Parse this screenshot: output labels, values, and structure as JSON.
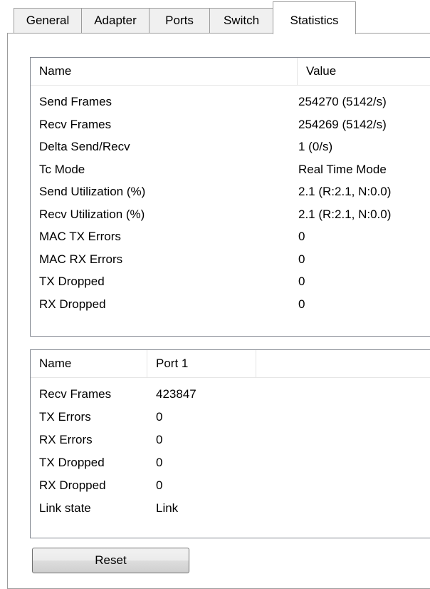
{
  "tabs": [
    {
      "label": "General"
    },
    {
      "label": "Adapter"
    },
    {
      "label": "Ports"
    },
    {
      "label": "Switch"
    },
    {
      "label": "Statistics"
    }
  ],
  "stats_table": {
    "headers": {
      "name": "Name",
      "value": "Value"
    },
    "rows": [
      {
        "name": "Send Frames",
        "value": "254270 (5142/s)"
      },
      {
        "name": "Recv Frames",
        "value": "254269 (5142/s)"
      },
      {
        "name": "Delta Send/Recv",
        "value": "1 (0/s)"
      },
      {
        "name": "Tc Mode",
        "value": "Real Time Mode"
      },
      {
        "name": "Send Utilization (%)",
        "value": "2.1 (R:2.1, N:0.0)"
      },
      {
        "name": "Recv Utilization (%)",
        "value": "2.1 (R:2.1, N:0.0)"
      },
      {
        "name": "MAC TX Errors",
        "value": "0"
      },
      {
        "name": "MAC RX Errors",
        "value": "0"
      },
      {
        "name": "TX Dropped",
        "value": "0"
      },
      {
        "name": "RX Dropped",
        "value": "0"
      }
    ]
  },
  "port_table": {
    "headers": {
      "name": "Name",
      "port1": "Port 1"
    },
    "rows": [
      {
        "name": "Recv Frames",
        "value": "423847"
      },
      {
        "name": "TX Errors",
        "value": "0"
      },
      {
        "name": "RX Errors",
        "value": "0"
      },
      {
        "name": "TX Dropped",
        "value": "0"
      },
      {
        "name": "RX Dropped",
        "value": "0"
      },
      {
        "name": "Link state",
        "value": "Link"
      }
    ]
  },
  "reset_button": {
    "label": "Reset"
  }
}
